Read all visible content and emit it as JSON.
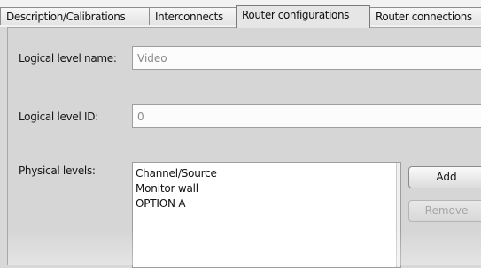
{
  "tabs": [
    {
      "label": "Description/Calibrations"
    },
    {
      "label": "Interconnects"
    },
    {
      "label": "Router configurations",
      "active": true
    },
    {
      "label": "Router connections"
    }
  ],
  "form": {
    "logical_level_name": {
      "label": "Logical level name:",
      "value": "Video"
    },
    "logical_level_id": {
      "label": "Logical level ID:",
      "value": "0"
    },
    "physical_levels": {
      "label": "Physical levels:",
      "items": [
        "Channel/Source",
        "Monitor wall",
        "OPTION A"
      ]
    }
  },
  "buttons": {
    "add_label": "Add",
    "remove_label": "Remove"
  }
}
